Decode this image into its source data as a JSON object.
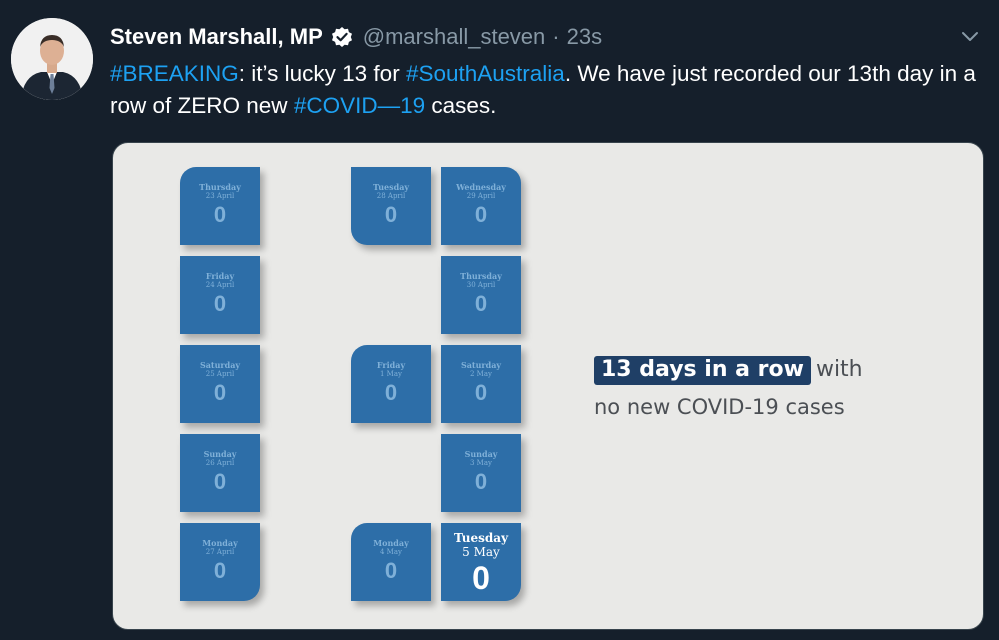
{
  "tweet": {
    "display_name": "Steven Marshall, MP",
    "handle": "@marshall_steven",
    "separator": "·",
    "time": "23s",
    "text_parts": [
      {
        "text": "#BREAKING",
        "hashtag": true
      },
      {
        "text": ": it’s lucky 13 for ",
        "hashtag": false
      },
      {
        "text": "#SouthAustralia",
        "hashtag": true
      },
      {
        "text": ". We have just recorded our 13th day in a row of ZERO new ",
        "hashtag": false
      },
      {
        "text": "#COVID—19",
        "hashtag": true
      },
      {
        "text": " cases.",
        "hashtag": false
      }
    ]
  },
  "graphic": {
    "headline_highlight": "13 days in a row",
    "headline_rest": "with",
    "subline": "no new COVID-19 cases",
    "tiles": [
      {
        "day": "Thursday",
        "date": "23 April",
        "count": "0"
      },
      {
        "day": "Friday",
        "date": "24 April",
        "count": "0"
      },
      {
        "day": "Saturday",
        "date": "25 April",
        "count": "0"
      },
      {
        "day": "Sunday",
        "date": "26 April",
        "count": "0"
      },
      {
        "day": "Monday",
        "date": "27 April",
        "count": "0"
      },
      {
        "day": "Tuesday",
        "date": "28 April",
        "count": "0"
      },
      {
        "day": "Wednesday",
        "date": "29 April",
        "count": "0"
      },
      {
        "day": "Thursday",
        "date": "30 April",
        "count": "0"
      },
      {
        "day": "Friday",
        "date": "1 May",
        "count": "0"
      },
      {
        "day": "Saturday",
        "date": "2 May",
        "count": "0"
      },
      {
        "day": "Sunday",
        "date": "3 May",
        "count": "0"
      },
      {
        "day": "Monday",
        "date": "4 May",
        "count": "0"
      },
      {
        "day": "Tuesday",
        "date": "5 May",
        "count": "0"
      }
    ]
  },
  "colors": {
    "background": "#151f2b",
    "hashtag": "#1da1f2",
    "tile": "#2d6ea8",
    "headline_box": "#1f3f66"
  },
  "icons": {
    "verified": "verified-badge-icon",
    "menu": "chevron-down-icon"
  }
}
